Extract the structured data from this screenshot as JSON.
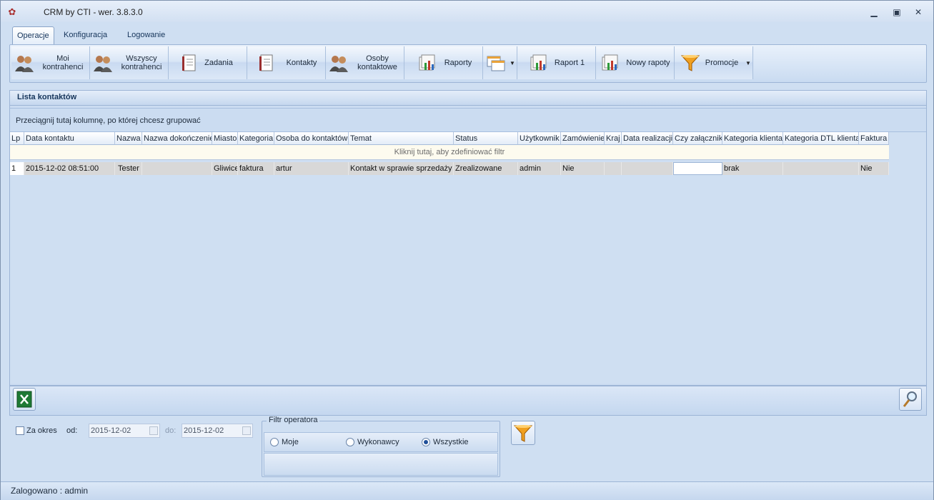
{
  "window": {
    "title": "CRM by CTI -  wer. 3.8.3.0",
    "controls": {
      "minimize": "minimize-icon",
      "restore": "restore-icon",
      "close": "close-icon"
    }
  },
  "tabs": [
    {
      "label": "Operacje",
      "active": true
    },
    {
      "label": "Konfiguracja",
      "active": false
    },
    {
      "label": "Logowanie",
      "active": false
    }
  ],
  "ribbon": {
    "buttons": [
      {
        "label": "Moi kontrahenci",
        "icon": "users-icon"
      },
      {
        "label": "Wszyscy kontrahenci",
        "icon": "users-icon"
      },
      {
        "label": "Zadania",
        "icon": "document-icon"
      },
      {
        "label": "Kontakty",
        "icon": "document-icon"
      },
      {
        "label": "Osoby kontaktowe",
        "icon": "users-icon"
      },
      {
        "label": "Raporty",
        "icon": "report-icon"
      },
      {
        "label": "",
        "icon": "windows-icon"
      },
      {
        "label": "Raport 1",
        "icon": "report-icon"
      },
      {
        "label": "Nowy rapoty",
        "icon": "report-icon"
      },
      {
        "label": "Promocje",
        "icon": "funnel-icon"
      }
    ]
  },
  "panel": {
    "title": "Lista kontaktów",
    "group_hint": "Przeciągnij tutaj kolumnę, po której chcesz grupować",
    "filter_hint": "Kliknij tutaj, aby zdefiniować filtr",
    "columns": [
      "Lp",
      "Data kontaktu",
      "Nazwa",
      "Nazwa dokończenie",
      "Miasto",
      "Kategoria",
      "Osoba do kontaktów",
      "Temat",
      "Status",
      "Użytkownik",
      "Zamówienie",
      "Kraj",
      "Data realizacji",
      "Czy załącznik",
      "Kategoria klienta",
      "Kategoria DTL klienta",
      "Faktura"
    ],
    "rows": [
      [
        "1",
        "2015-12-02 08:51:00",
        "Tester",
        "",
        "Gliwice",
        "faktura",
        "artur",
        "Kontakt w sprawie sprzedaży",
        "Zrealizowane",
        "admin",
        "Nie",
        "",
        "",
        "",
        "brak",
        "",
        "Nie"
      ]
    ]
  },
  "bottombar": {
    "left_icon": "excel-icon",
    "right_icon": "magnifier-icon"
  },
  "filters": {
    "za_okres_label": "Za okres",
    "od_label": "od:",
    "od_value": "2015-12-02",
    "do_label": "do:",
    "do_value": "2015-12-02",
    "operator_legend": "Filtr operatora",
    "options": [
      {
        "label": "Moje",
        "selected": false
      },
      {
        "label": "Wykonawcy",
        "selected": false
      },
      {
        "label": "Wszystkie",
        "selected": true
      }
    ],
    "apply_icon": "funnel-icon"
  },
  "status": {
    "text": "Zalogowano : admin"
  }
}
